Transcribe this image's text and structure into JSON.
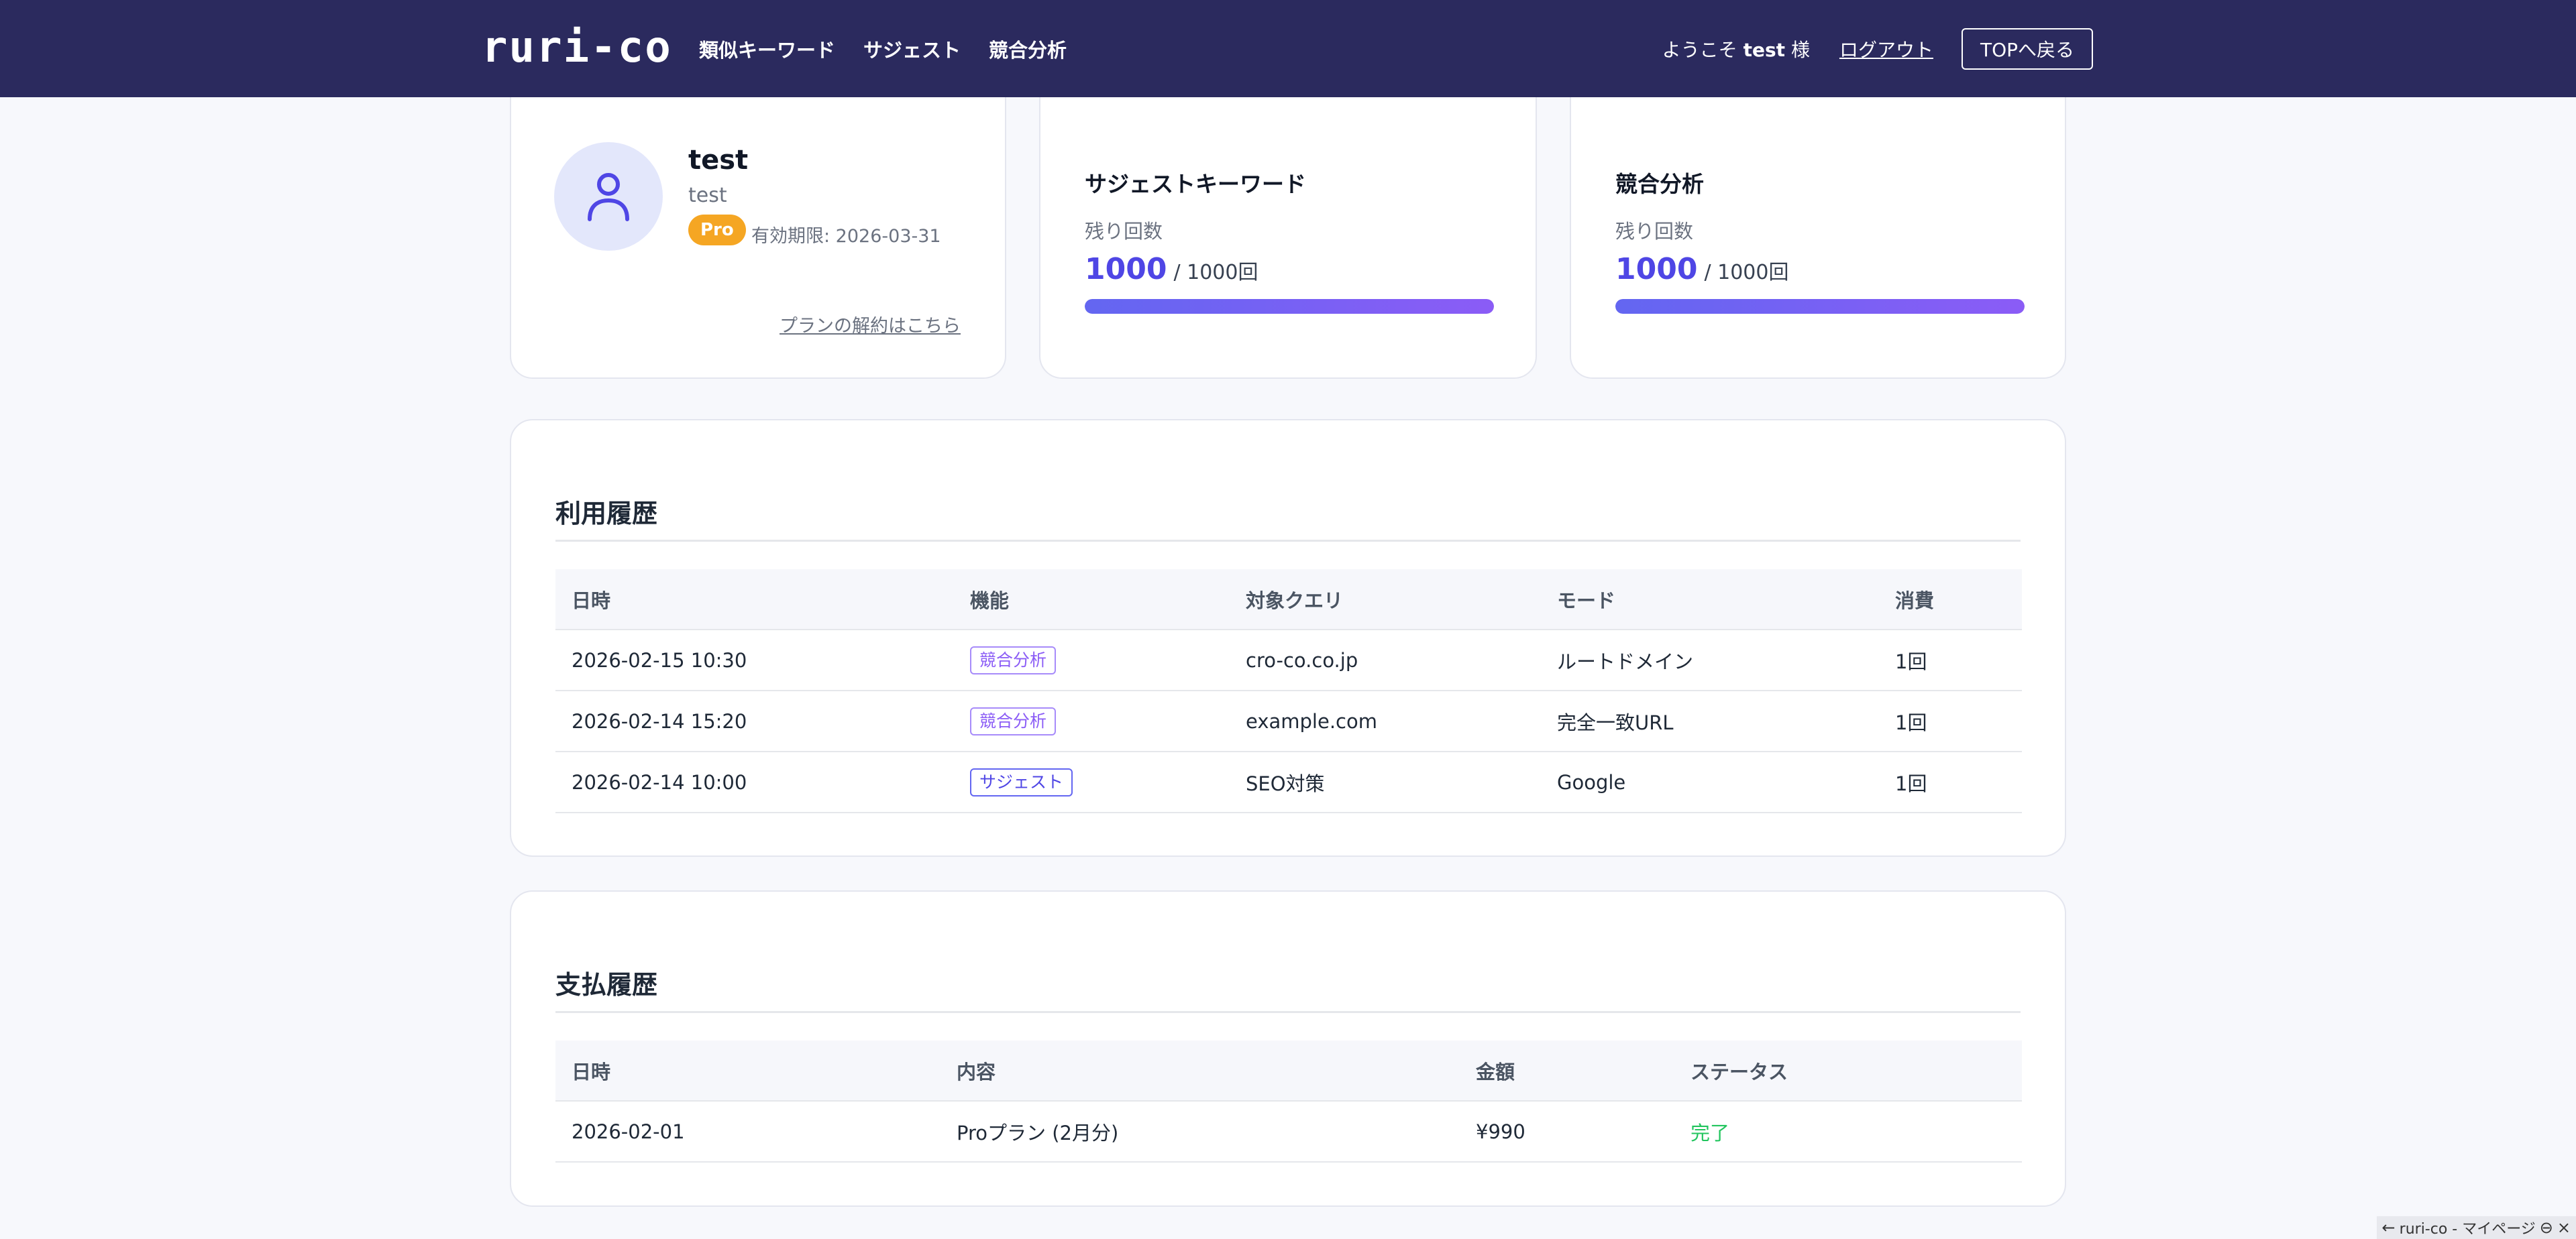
{
  "header": {
    "logo": "ruri-co",
    "nav": [
      "類似キーワード",
      "サジェスト",
      "競合分析"
    ],
    "welcome_prefix": "ようこそ",
    "user": "test",
    "welcome_suffix": "様",
    "logout": "ログアウト",
    "top_button": "TOPへ戻る"
  },
  "profile": {
    "name": "test",
    "subtitle": "test",
    "plan_badge": "Pro",
    "expiry": "有効期限: 2026-03-31",
    "cancel_link": "プランの解約はこちら"
  },
  "quotas": [
    {
      "title": "サジェストキーワード",
      "label": "残り回数",
      "remaining": "1000",
      "total": "/ 1000回",
      "fraction": 1.0
    },
    {
      "title": "競合分析",
      "label": "残り回数",
      "remaining": "1000",
      "total": "/ 1000回",
      "fraction": 1.0
    }
  ],
  "usage": {
    "title": "利用履歴",
    "columns": [
      "日時",
      "機能",
      "対象クエリ",
      "モード",
      "消費"
    ],
    "rows": [
      {
        "datetime": "2026-02-15 10:30",
        "feature": "競合分析",
        "query": "cro-co.co.jp",
        "mode": "ルートドメイン",
        "cost": "1回"
      },
      {
        "datetime": "2026-02-14 15:20",
        "feature": "競合分析",
        "query": "example.com",
        "mode": "完全一致URL",
        "cost": "1回"
      },
      {
        "datetime": "2026-02-14 10:00",
        "feature": "サジェスト",
        "query": "SEO対策",
        "mode": "Google",
        "cost": "1回"
      }
    ]
  },
  "payments": {
    "title": "支払履歴",
    "columns": [
      "日時",
      "内容",
      "金額",
      "ステータス"
    ],
    "rows": [
      {
        "date": "2026-02-01",
        "description": "Proプラン (2月分)",
        "amount": "¥990",
        "status": "完了"
      }
    ]
  },
  "status_chip": "ruri-co - マイページ",
  "colors": {
    "header_bg": "#2b2a5e",
    "accent": "#4f46e5",
    "badge_pro": "#f5a623",
    "tag_competitor": "#8b5cf6",
    "status_done": "#22c55e"
  }
}
